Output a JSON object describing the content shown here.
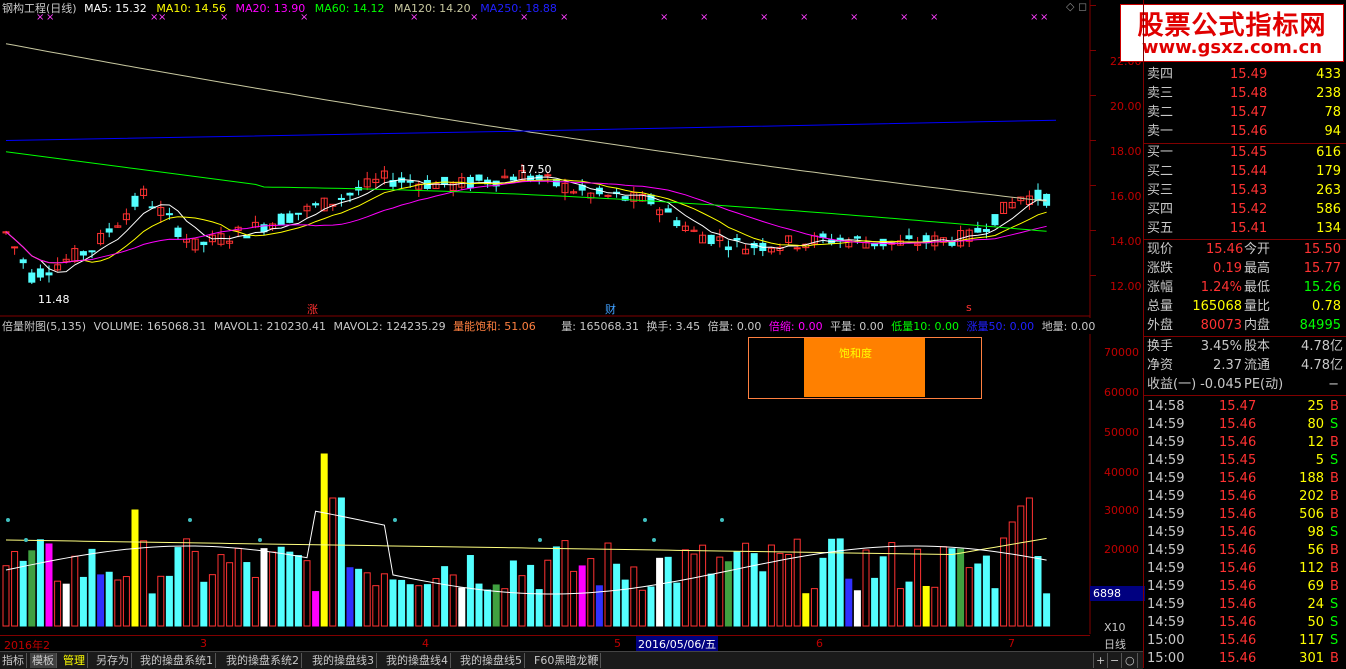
{
  "header": {
    "title": "钢构工程(日线)",
    "ma5": "MA5: 15.32",
    "ma10": "MA10: 14.56",
    "ma20": "MA20: 13.90",
    "ma60": "MA60: 14.12",
    "ma120": "MA120: 14.20",
    "ma250": "MA250: 18.88"
  },
  "price_axis": [
    "24",
    "22.00",
    "20.00",
    "18.00",
    "16.00",
    "14.00",
    "12.00"
  ],
  "price_marks": {
    "high": "17.50",
    "low": "11.48",
    "zhang": "涨",
    "cai": "财",
    "s": "s"
  },
  "vol_header": {
    "name": "倍量附图(5,135)",
    "volume": "VOLUME: 165068.31",
    "mavol1": "MAVOL1: 210230.41",
    "mavol2": "MAVOL2: 124235.29",
    "saturation": "量能饱和: 51.06",
    "liang": "量: 165068.31",
    "huanshou": "换手: 3.45",
    "beiliang": "倍量: 0.00",
    "beisuo": "倍缩: 0.00",
    "pingliang": "平量: 0.00",
    "diliang": "低量10: 0.00",
    "zhangliang": "涨量50: 0.00",
    "diliang2": "地量: 0.00"
  },
  "vol_axis": [
    "70000",
    "60000",
    "50000",
    "40000",
    "30000",
    "20000",
    "10000"
  ],
  "vol_marker": "6898",
  "vol_scale": "X10",
  "saturation_box": "饱和度",
  "date_axis": [
    "2016年2",
    "3",
    "4",
    "5",
    "2016/05/06/五",
    "6",
    "7"
  ],
  "period": "日线",
  "tabs": [
    "指标",
    "模板",
    "管理",
    "另存为",
    "我的操盘系统1",
    "我的操盘系统2",
    "我的操盘线3",
    "我的操盘线4",
    "我的操盘线5",
    "F60黑暗龙鞭"
  ],
  "tab_controls": [
    "+",
    "−",
    "○"
  ],
  "banner": {
    "title": "股票公式指标网",
    "url": "www.gsxz.com.cn"
  },
  "order_book": {
    "sell": [
      {
        "label": "卖四",
        "price": "15.49",
        "vol": "433"
      },
      {
        "label": "卖三",
        "price": "15.48",
        "vol": "238"
      },
      {
        "label": "卖二",
        "price": "15.47",
        "vol": "78"
      },
      {
        "label": "卖一",
        "price": "15.46",
        "vol": "94"
      }
    ],
    "buy": [
      {
        "label": "买一",
        "price": "15.45",
        "vol": "616"
      },
      {
        "label": "买二",
        "price": "15.44",
        "vol": "179"
      },
      {
        "label": "买三",
        "price": "15.43",
        "vol": "263"
      },
      {
        "label": "买四",
        "price": "15.42",
        "vol": "586"
      },
      {
        "label": "买五",
        "price": "15.41",
        "vol": "134"
      }
    ]
  },
  "quote": [
    {
      "l1": "现价",
      "v1": "15.46",
      "l2": "今开",
      "v2": "15.50"
    },
    {
      "l1": "涨跌",
      "v1": "0.19",
      "l2": "最高",
      "v2": "15.77"
    },
    {
      "l1": "涨幅",
      "v1": "1.24%",
      "l2": "最低",
      "v2": "15.26"
    },
    {
      "l1": "总量",
      "v1": "165068",
      "l2": "量比",
      "v2": "0.78"
    },
    {
      "l1": "外盘",
      "v1": "80073",
      "l2": "内盘",
      "v2": "84995"
    }
  ],
  "stats": [
    {
      "l1": "换手",
      "v1": "3.45%",
      "l2": "股本",
      "v2": "4.78亿"
    },
    {
      "l1": "净资",
      "v1": "2.37",
      "l2": "流通",
      "v2": "4.78亿"
    },
    {
      "l1": "收益(一)",
      "v1": "-0.045",
      "l2": "PE(动)",
      "v2": "−"
    }
  ],
  "ticks": [
    {
      "time": "14:58",
      "price": "15.47",
      "vol": "25",
      "side": "B"
    },
    {
      "time": "14:59",
      "price": "15.46",
      "vol": "80",
      "side": "S"
    },
    {
      "time": "14:59",
      "price": "15.46",
      "vol": "12",
      "side": "B"
    },
    {
      "time": "14:59",
      "price": "15.45",
      "vol": "5",
      "side": "S"
    },
    {
      "time": "14:59",
      "price": "15.46",
      "vol": "188",
      "side": "B"
    },
    {
      "time": "14:59",
      "price": "15.46",
      "vol": "202",
      "side": "B"
    },
    {
      "time": "14:59",
      "price": "15.46",
      "vol": "506",
      "side": "B"
    },
    {
      "time": "14:59",
      "price": "15.46",
      "vol": "98",
      "side": "S"
    },
    {
      "time": "14:59",
      "price": "15.46",
      "vol": "56",
      "side": "B"
    },
    {
      "time": "14:59",
      "price": "15.46",
      "vol": "112",
      "side": "B"
    },
    {
      "time": "14:59",
      "price": "15.46",
      "vol": "69",
      "side": "B"
    },
    {
      "time": "14:59",
      "price": "15.46",
      "vol": "24",
      "side": "S"
    },
    {
      "time": "14:59",
      "price": "15.46",
      "vol": "50",
      "side": "S"
    },
    {
      "time": "15:00",
      "price": "15.46",
      "vol": "117",
      "side": "S"
    },
    {
      "time": "15:00",
      "price": "15.46",
      "vol": "301",
      "side": "B"
    }
  ],
  "colors": {
    "up": "#ff3232",
    "down": "#54ffff",
    "ma5": "#ffffff",
    "ma10": "#ffff00",
    "ma20": "#ff00ff",
    "ma60": "#00ff00",
    "ma120": "#c8c8a0",
    "ma250": "#0000ff"
  }
}
